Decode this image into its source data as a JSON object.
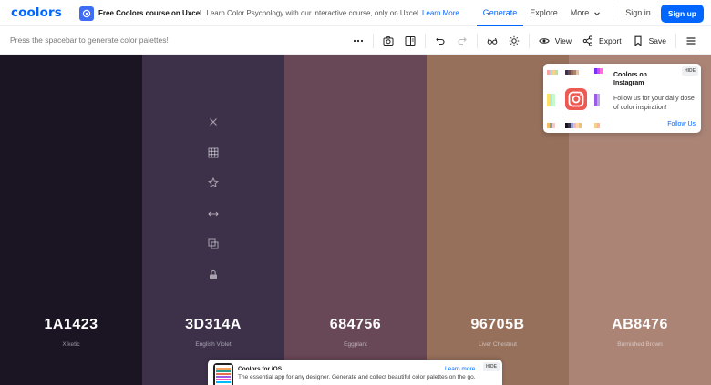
{
  "app": {
    "logo": "coolors"
  },
  "promo": {
    "title": "Free Coolors course on Uxcel",
    "text": "Learn Color Psychology with our interactive course, only on Uxcel",
    "link": "Learn More"
  },
  "nav": {
    "generate": "Generate",
    "explore": "Explore",
    "more": "More",
    "signin": "Sign in",
    "signup": "Sign up"
  },
  "toolbar": {
    "hint": "Press the spacebar to generate color palettes!",
    "view": "View",
    "export": "Export",
    "save": "Save"
  },
  "palette": [
    {
      "hex": "1A1423",
      "name": "Xiketic",
      "color": "#1A1423"
    },
    {
      "hex": "3D314A",
      "name": "English Violet",
      "color": "#3D314A"
    },
    {
      "hex": "684756",
      "name": "Eggplant",
      "color": "#684756"
    },
    {
      "hex": "96705B",
      "name": "Liver Chestnut",
      "color": "#96705B"
    },
    {
      "hex": "AB8476",
      "name": "Burnished Brown",
      "color": "#AB8476"
    }
  ],
  "ig_card": {
    "hide": "HIDE",
    "title": "Coolors on Instagram",
    "text": "Follow us for your daily dose of color inspiration!",
    "link": "Follow Us"
  },
  "ios_card": {
    "hide": "HIDE",
    "title": "Coolors for iOS",
    "text": "The essential app for any designer. Generate and collect beautiful color palettes on the go.",
    "link": "Learn more"
  },
  "colors": {
    "accent": "#0066ff"
  }
}
